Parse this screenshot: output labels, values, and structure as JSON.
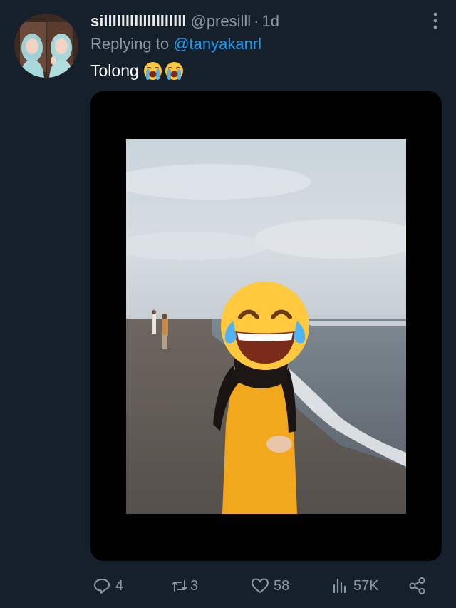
{
  "tweet": {
    "author_name": "silllllllllllllllllll",
    "author_handle": "@presilll",
    "separator": "·",
    "time": "1d",
    "replying_prefix": "Replying to",
    "replying_to": "@tanyakanrl",
    "text": "Tolong",
    "emojis": [
      "loudly-crying-face",
      "loudly-crying-face"
    ]
  },
  "media": {
    "face_cover_emoji": "face-with-tears-of-joy"
  },
  "actions": {
    "replies": "4",
    "retweets": "3",
    "likes": "58",
    "views": "57K"
  },
  "colors": {
    "background": "#15202b",
    "secondary_text": "#8b98a5",
    "link": "#1d9bf0"
  }
}
